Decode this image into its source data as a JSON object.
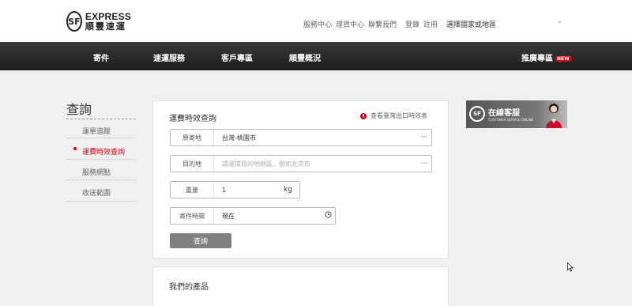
{
  "logo": {
    "mark": "SF",
    "en": "EXPRESS",
    "zh": "順豐速運"
  },
  "toplinks": [
    "服務中心",
    "理貨中心",
    "聯繫我們"
  ],
  "account": [
    "登錄",
    "註冊"
  ],
  "region": {
    "label": "選擇國家或地區",
    "chevron": "⌄"
  },
  "nav": {
    "items": [
      "寄件",
      "速運服務",
      "客戶專區",
      "順豐概況"
    ],
    "promo": "推廣專區",
    "promo_badge": "NEW"
  },
  "sidebar": {
    "title": "查詢",
    "items": [
      "運單追蹤",
      "運費時效查詢",
      "服務網點",
      "收送範圍"
    ],
    "active_index": 1
  },
  "panel": {
    "title": "運費時效查詢",
    "taiwan_link": "查看臺灣出口時效表",
    "origin": {
      "label": "原寄地",
      "value": "台灣-桃園市"
    },
    "destination": {
      "label": "目的地",
      "placeholder": "請選擇目的地地區，例如北京市"
    },
    "weight": {
      "label": "重量",
      "value": "1",
      "unit": "kg"
    },
    "time": {
      "label": "寄件時間",
      "value": "現在"
    },
    "more_icon": "···",
    "submit": "查詢"
  },
  "products": {
    "title": "我們的產品"
  },
  "cs_banner": {
    "logo": "SF",
    "title": "在線客服",
    "subtitle": "CUSTOMER SERVICE ONLINE"
  },
  "colors": {
    "accent": "#d7000f",
    "nav_bg": "#2a2a2a",
    "button": "#808080"
  }
}
